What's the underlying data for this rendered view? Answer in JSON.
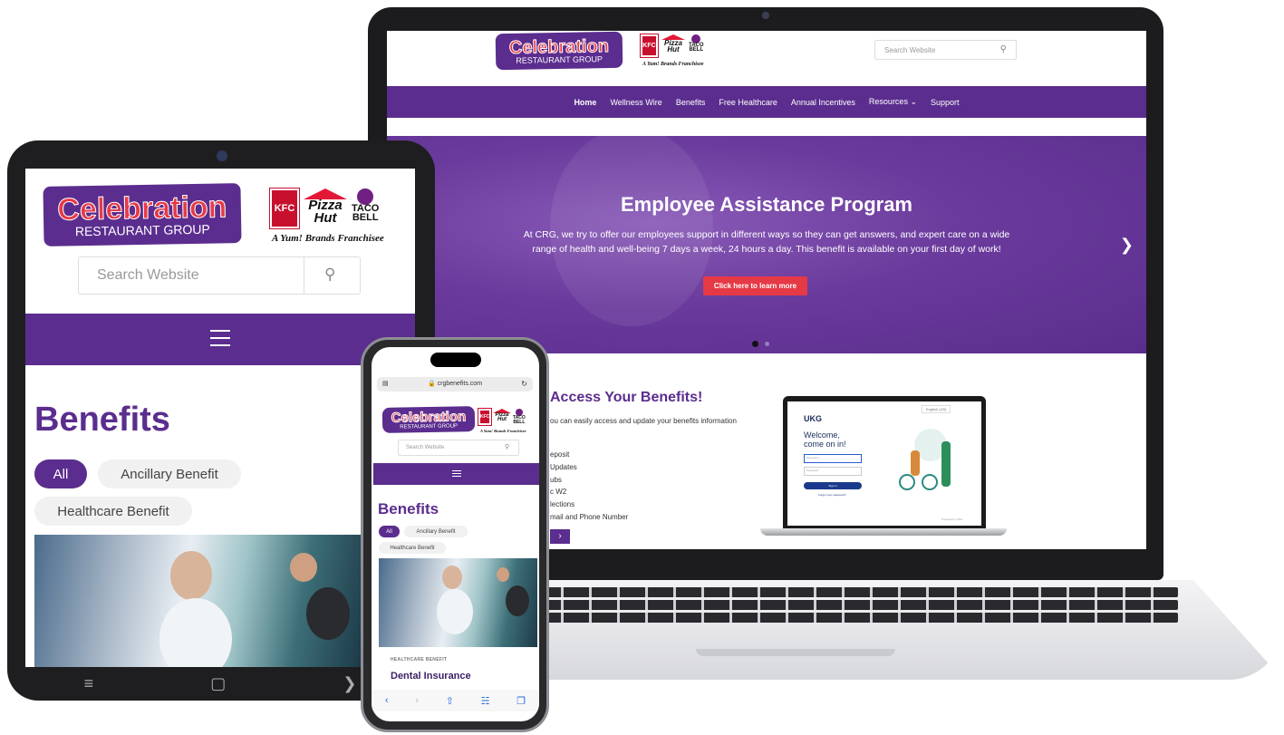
{
  "brand": {
    "logo_line1": "Celebration",
    "logo_line2": "RESTAURANT GROUP",
    "kfc": "KFC",
    "pizza_hut_1": "Pizza",
    "pizza_hut_2": "Hut",
    "taco_bell_1": "TACO",
    "taco_bell_2": "BELL",
    "franchisee": "A Yum! Brands Franchisee"
  },
  "laptop": {
    "search_placeholder": "Search Website",
    "nav": {
      "home": "Home",
      "wellness": "Wellness Wire",
      "benefits": "Benefits",
      "healthcare": "Free Healthcare",
      "incentives": "Annual Incentives",
      "resources": "Resources",
      "support": "Support"
    },
    "hero": {
      "title": "Employee Assistance Program",
      "body": "At CRG, we try to offer our employees support in different ways so they can get answers, and expert care on a wide range of health and well-being 7 days a week, 24 hours a day. This benefit is available on your first day of work!",
      "button": "Click here to learn more"
    },
    "access": {
      "title": "Access Your Benefits!",
      "desc": "ou can easily access and update your benefits information",
      "items": [
        "eposit",
        "Updates",
        "ubs",
        "c W2",
        "lections",
        "mail and Phone Number"
      ]
    },
    "ukg": {
      "logo": "UKG",
      "welcome_1": "Welcome,",
      "welcome_2": "come on in!",
      "lang": "English (US)",
      "username": "Username",
      "password": "Password",
      "signin": "Sign in",
      "forgot": "Forgot your password?",
      "powered": "Powered by UKG"
    }
  },
  "tablet": {
    "search_placeholder": "Search Website",
    "title": "Benefits",
    "chips": [
      "All",
      "Ancillary Benefit",
      "Healthcare Benefit"
    ]
  },
  "phone": {
    "url": "crgbenefits.com",
    "search_placeholder": "Search Website",
    "title": "Benefits",
    "chips": [
      "All",
      "Ancillary Benefit",
      "Healthcare Benefit"
    ],
    "card_tag": "HEALTHCARE BENEFIT",
    "card_title": "Dental Insurance"
  },
  "colors": {
    "brand_purple": "#5b2d8e",
    "accent_red": "#e63946"
  }
}
